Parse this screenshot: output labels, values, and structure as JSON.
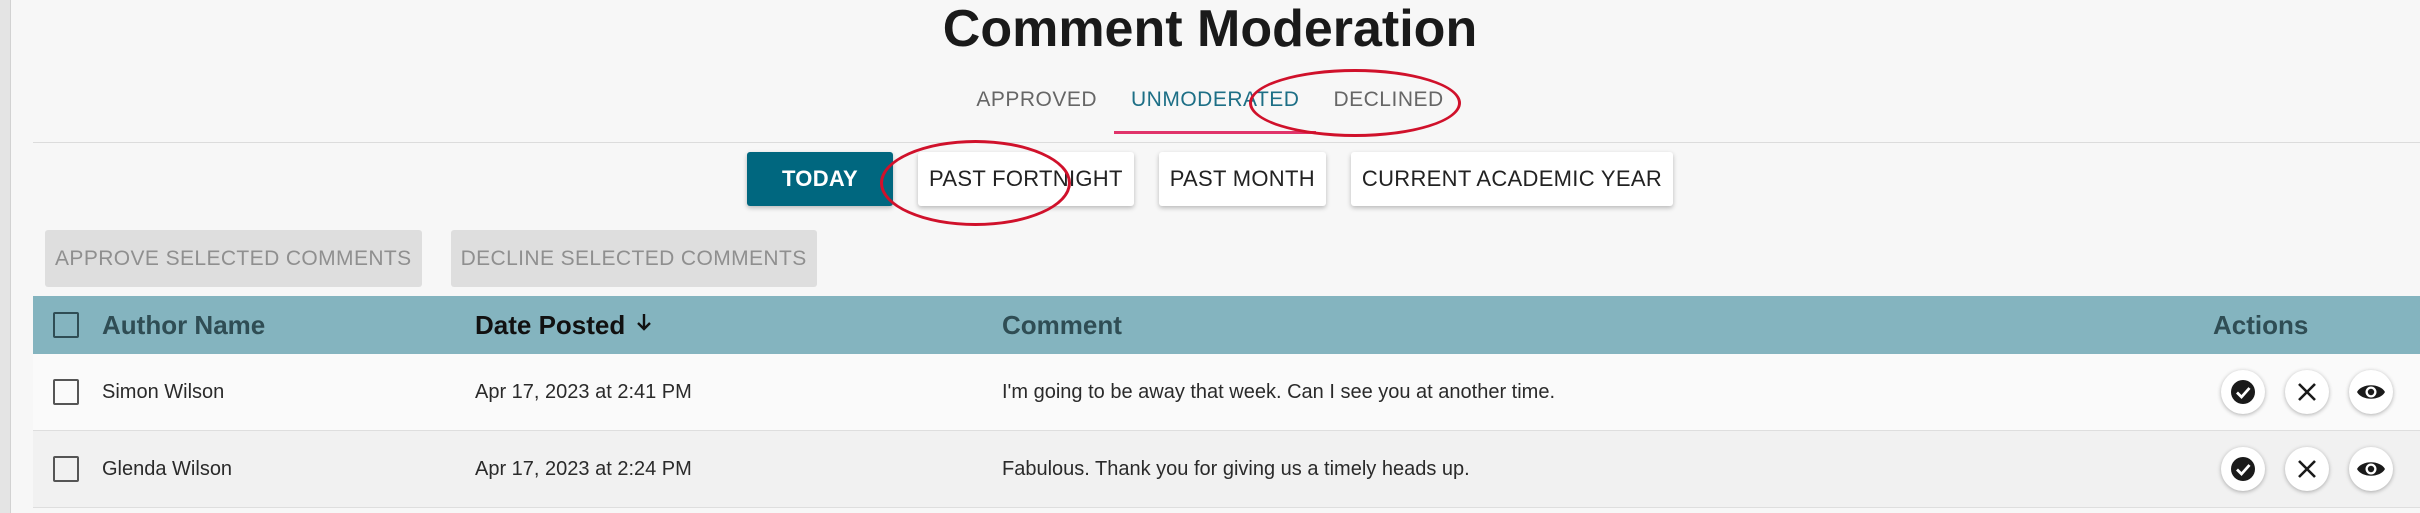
{
  "page": {
    "title": "Comment Moderation"
  },
  "tabs": [
    {
      "label": "APPROVED"
    },
    {
      "label": "UNMODERATED",
      "active": true
    },
    {
      "label": "DECLINED"
    }
  ],
  "filters": [
    {
      "label": "TODAY",
      "active": true
    },
    {
      "label": "PAST FORTNIGHT"
    },
    {
      "label": "PAST MONTH"
    },
    {
      "label": "CURRENT ACADEMIC YEAR"
    }
  ],
  "bulk_actions": {
    "approve_label": "APPROVE SELECTED COMMENTS",
    "decline_label": "DECLINE SELECTED COMMENTS"
  },
  "table": {
    "columns": {
      "author": "Author Name",
      "date": "Date Posted",
      "comment": "Comment",
      "actions": "Actions"
    },
    "sort_icon": "arrow-down-icon",
    "rows": [
      {
        "author": "Simon Wilson",
        "date": "Apr 17, 2023 at 2:41 PM",
        "comment": "I'm going to be away that week. Can I see you at another time."
      },
      {
        "author": "Glenda Wilson",
        "date": "Apr 17, 2023 at 2:24 PM",
        "comment": "Fabulous. Thank you for giving us a timely heads up."
      }
    ],
    "row_actions": [
      "approve-check-icon",
      "decline-x-icon",
      "view-eye-icon"
    ]
  },
  "colors": {
    "accent": "#00677f",
    "tab_active_text": "#1d6f86",
    "tab_indicator": "#e0336a",
    "header_bg": "#84b4bf",
    "annotation": "#d0112b"
  }
}
